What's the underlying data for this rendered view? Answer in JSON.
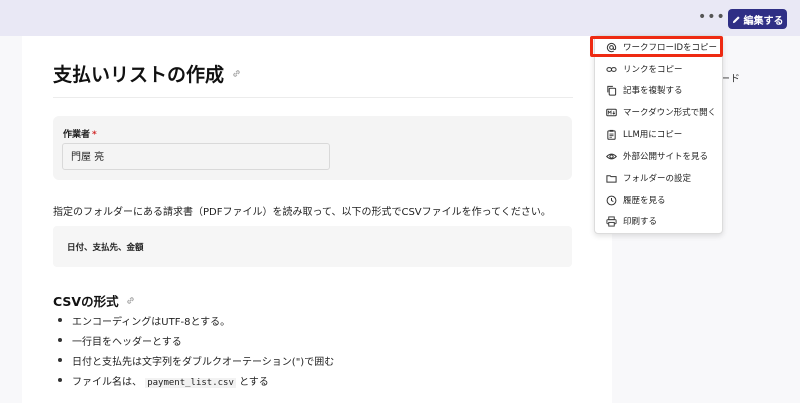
{
  "topbar": {
    "more_label": "•••",
    "edit_label": "編集する"
  },
  "sidebar": {
    "partial_text": "ード"
  },
  "page": {
    "title": "支払いリストの作成",
    "author_label": "作業者",
    "required_mark": "*",
    "author_value": "門屋 亮",
    "instruction": "指定のフォルダーにある請求書（PDFファイル）を読み取って、以下の形式でCSVファイルを作ってください。",
    "code_text": "日付、支払先、金額",
    "section_title": "CSVの形式",
    "bullets": [
      {
        "text": "エンコーディングはUTF-8とする。"
      },
      {
        "text": "一行目をヘッダーとする"
      },
      {
        "text": "日付と支払先は文字列をダブルクオーテーション(\")で囲む"
      },
      {
        "prefix": "ファイル名は、",
        "code": "payment_list.csv",
        "suffix": "とする"
      }
    ]
  },
  "menu": {
    "items": [
      {
        "label": "ワークフローIDをコピー",
        "icon": "at-icon"
      },
      {
        "label": "リンクをコピー",
        "icon": "link-icon"
      },
      {
        "label": "記事を複製する",
        "icon": "duplicate-icon"
      },
      {
        "label": "マークダウン形式で開く",
        "icon": "markdown-icon"
      },
      {
        "label": "LLM用にコピー",
        "icon": "clipboard-icon"
      },
      {
        "label": "外部公開サイトを見る",
        "icon": "eye-icon"
      },
      {
        "label": "フォルダーの設定",
        "icon": "folder-icon"
      },
      {
        "label": "履歴を見る",
        "icon": "clock-icon"
      },
      {
        "label": "印刷する",
        "icon": "printer-icon"
      }
    ]
  },
  "colors": {
    "accent": "#2f2f85",
    "highlight": "#ee2a12",
    "topbar": "#e9e8f5"
  }
}
